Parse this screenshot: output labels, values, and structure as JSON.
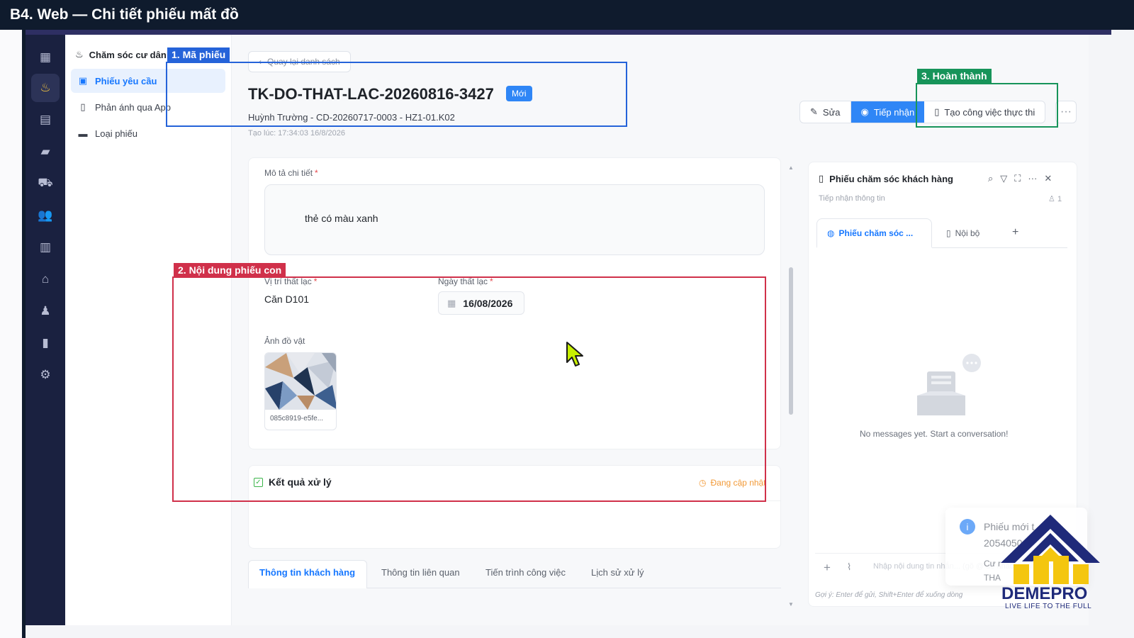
{
  "banner": {
    "title": "B4. Web — Chi tiết phiếu mất đồ"
  },
  "rail": {
    "icons": [
      "building-icon",
      "resident-care-icon",
      "calculator-icon",
      "briefcase-icon",
      "car-icon",
      "users-icon",
      "apartment-icon",
      "store-icon",
      "person-icon",
      "chart-icon",
      "settings-icon"
    ]
  },
  "subnav": {
    "header": "Chăm sóc cư dân",
    "items": [
      {
        "label": "Phiếu yêu cầu",
        "icon": "ticket-icon"
      },
      {
        "label": "Phản ánh qua App",
        "icon": "phone-icon"
      },
      {
        "label": "Loại phiếu",
        "icon": "card-icon"
      }
    ]
  },
  "detail": {
    "back_label": "Quay lại danh sách",
    "ticket_code": "TK-DO-THAT-LAC-20260816-3427",
    "status_badge": "Mới",
    "subtitle": "Huỳnh Trường - CD-20260717-0003 - HZ1-01.K02",
    "created_at": "Tạo lúc: 17:34:03 16/8/2026",
    "actions": {
      "edit": "Sửa",
      "receive": "Tiếp nhận",
      "create_task": "Tạo công việc thực thi",
      "more": "···"
    },
    "description_label": "Mô tả chi tiết",
    "description_value": "thẻ có màu xanh",
    "location_label": "Vị trí thất lạc",
    "location_value": "Căn D101",
    "lost_date_label": "Ngày thất lạc",
    "lost_date_value": "16/08/2026",
    "photo_label": "Ảnh đồ vật",
    "photo_filename": "085c8919-e5fe...",
    "result_title": "Kết quả xử lý",
    "result_status": "Đang cập nhật",
    "tabs": [
      "Thông tin khách hàng",
      "Thông tin liên quan",
      "Tiến trình công việc",
      "Lịch sử xử lý"
    ]
  },
  "chat": {
    "title": "Phiếu chăm sóc khách hàng",
    "subtitle": "Tiếp nhận thông tin",
    "participant_count": "1",
    "tabs": [
      "Phiếu chăm sóc ...",
      "Nội bộ",
      "+"
    ],
    "empty_text": "No messages yet. Start a conversation!",
    "input_placeholder": "Nhập nội dung tin nhắn... (gõ @ để nhắc thành viên)",
    "hint": "Gợi ý: Enter để gửi, Shift+Enter để xuống dòng"
  },
  "toast": {
    "line1": "Phiếu mới t",
    "line2": "2054050",
    "line3": "Cư r",
    "line4": "THA"
  },
  "annotations": {
    "a1": {
      "label": "1. Mã phiếu",
      "color": "#2563d9"
    },
    "a2": {
      "label": "2. Nội dung phiếu con",
      "color": "#d0304a"
    },
    "a3": {
      "label": "3. Hoàn thành",
      "color": "#17945a"
    }
  },
  "brand": {
    "name": "DEMEPRO",
    "tagline": "LIVE LIFE TO THE FULL"
  }
}
